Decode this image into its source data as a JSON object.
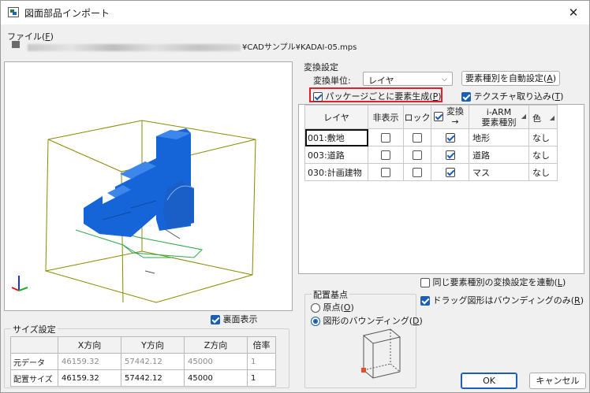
{
  "window": {
    "title": "図面部品インポート",
    "close_glyph": "✕"
  },
  "file": {
    "label": "ファイル(",
    "label_key": "F",
    "label_end": ")",
    "path_tail": "¥CADサンプル¥KADAI-05.mps"
  },
  "conversion": {
    "group_title": "変換設定",
    "unit_label": "変換単位:",
    "unit_value": "レイヤ",
    "auto_button": "要素種別を自動設定(",
    "auto_button_key": "A",
    "auto_button_end": ")",
    "package_label": "パッケージごとに要素生成(",
    "package_key": "P",
    "package_end": ")",
    "package_checked": true,
    "texture_label": "テクスチャ取り込み(",
    "texture_key": "T",
    "texture_end": ")",
    "texture_checked": true,
    "link_label": "同じ要素種別の変換設定を連動(",
    "link_key": "L",
    "link_end": ")",
    "link_checked": false
  },
  "layer_table": {
    "headers": {
      "layer": "レイヤ",
      "hidden": "非表示",
      "lock": "ロック",
      "convert_line1": "変換",
      "convert_line2": "→",
      "iarm_line1": "i-ARM",
      "iarm_line2": "要素種別",
      "color": "色"
    },
    "rows": [
      {
        "layer": "001:敷地",
        "hidden": false,
        "lock": false,
        "convert": true,
        "type": "地形",
        "color": "なし"
      },
      {
        "layer": "003:道路",
        "hidden": false,
        "lock": false,
        "convert": true,
        "type": "道路",
        "color": "なし"
      },
      {
        "layer": "030:計画建物",
        "hidden": false,
        "lock": false,
        "convert": true,
        "type": "マス",
        "color": "なし"
      }
    ]
  },
  "preview": {
    "backface_label": "裏面表示",
    "backface_checked": true,
    "colors": {
      "mass": "#1565d8",
      "bbox": "#8a8a00",
      "ground": "#2ea84a",
      "axis_x": "#e02020",
      "axis_y": "#20b020",
      "axis_z": "#2030e0"
    }
  },
  "base_point": {
    "group_title": "配置基点",
    "origin_label": "原点(",
    "origin_key": "O",
    "origin_end": ")",
    "bbox_label": "図形のバウンディング(",
    "bbox_key": "D",
    "bbox_end": ")",
    "selected": "bbox"
  },
  "drag_option": {
    "label": "ドラッグ図形はバウンディングのみ(",
    "key": "R",
    "end": ")",
    "checked": true
  },
  "size": {
    "group_title": "サイズ設定",
    "headers": [
      "",
      "X方向",
      "Y方向",
      "Z方向",
      "倍率"
    ],
    "rows": [
      {
        "label": "元データ",
        "x": "46159.32",
        "y": "57442.12",
        "z": "45000",
        "scale": "1"
      },
      {
        "label": "配置サイズ",
        "x": "46159.32",
        "y": "57442.12",
        "z": "45000",
        "scale": "1"
      }
    ]
  },
  "buttons": {
    "ok": "OK",
    "cancel": "キャンセル"
  }
}
